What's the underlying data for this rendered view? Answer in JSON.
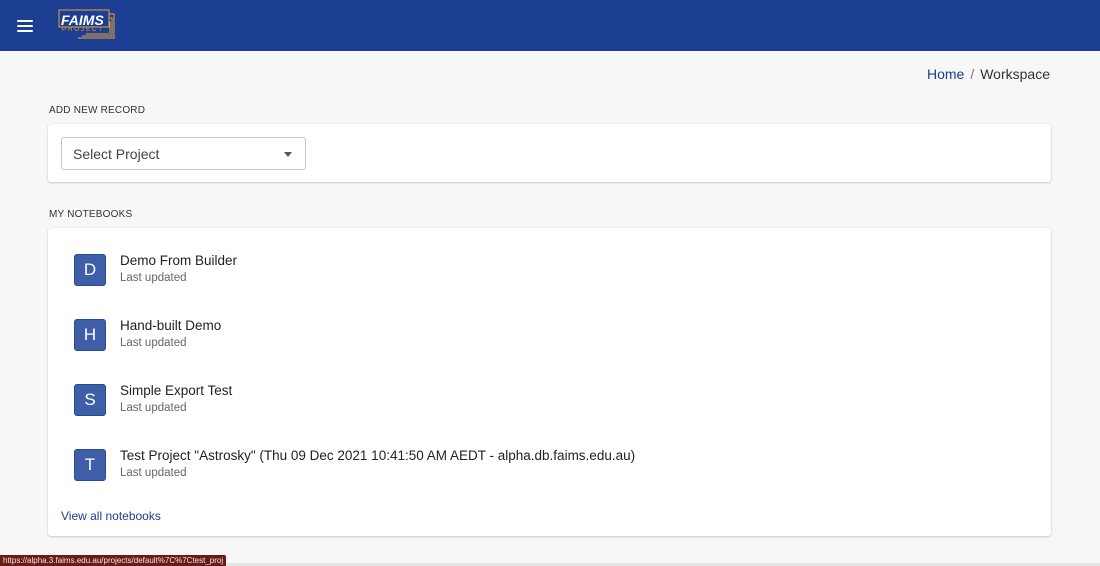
{
  "appbar": {
    "menu_icon": "hamburger-menu-icon",
    "logo_text": "FAIMS",
    "logo_sub": "PROJECT",
    "bg_color": "#1c3e93"
  },
  "breadcrumb": {
    "home": "Home",
    "separator": "/",
    "current": "Workspace"
  },
  "add_record": {
    "section_label": "ADD NEW RECORD",
    "select_placeholder": "Select Project"
  },
  "notebooks": {
    "section_label": "MY NOTEBOOKS",
    "items": [
      {
        "initial": "D",
        "title": "Demo From Builder",
        "subtitle": "Last updated"
      },
      {
        "initial": "H",
        "title": "Hand-built Demo",
        "subtitle": "Last updated"
      },
      {
        "initial": "S",
        "title": "Simple Export Test",
        "subtitle": "Last updated"
      },
      {
        "initial": "T",
        "title": "Test Project \"Astrosky\" (Thu 09 Dec 2021 10:41:50 AM AEDT - alpha.db.faims.edu.au)",
        "subtitle": "Last updated"
      }
    ],
    "view_all": "View all notebooks"
  },
  "status_bar": {
    "url": "https://alpha.3.faims.edu.au/projects/default%7C%7Ctest_proj"
  }
}
